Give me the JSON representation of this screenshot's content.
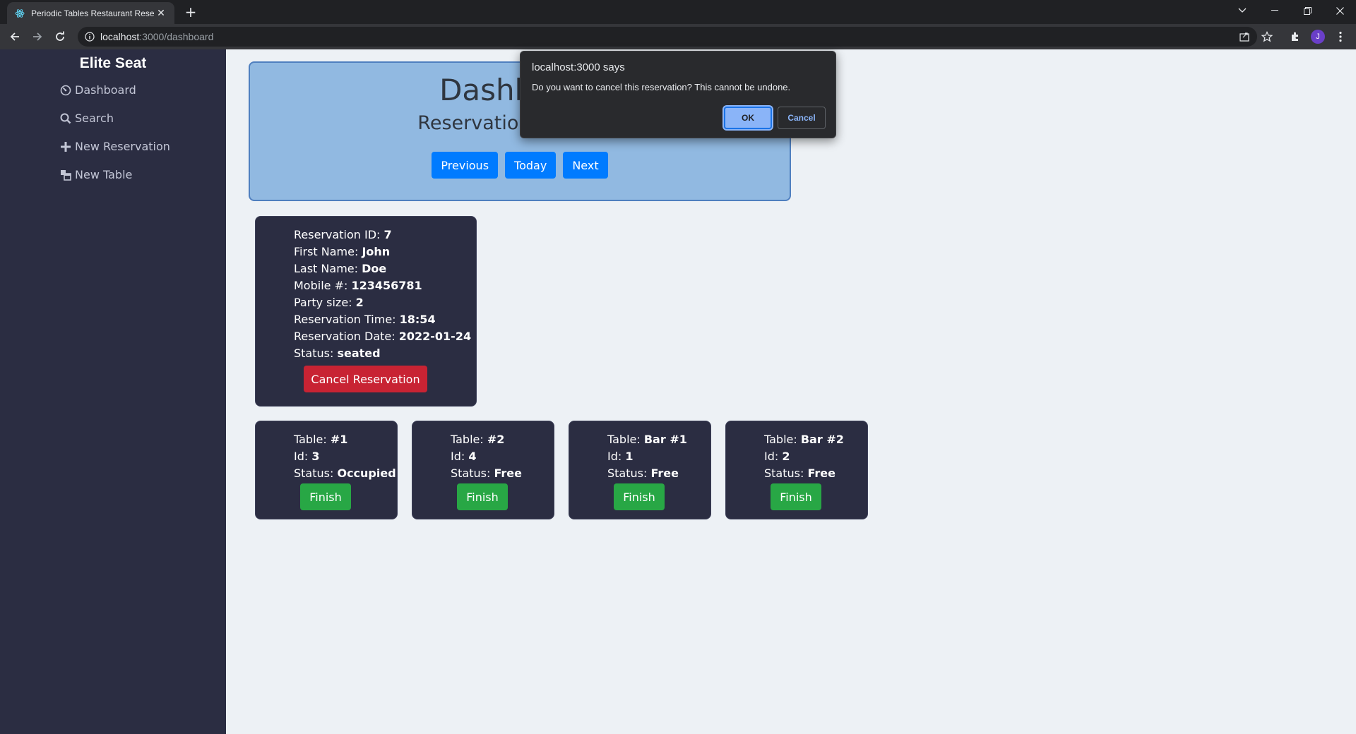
{
  "browser": {
    "tab_title": "Periodic Tables Restaurant Reservation",
    "tab_close": "✕",
    "new_tab": "+",
    "url_host": "localhost",
    "url_path": ":3000/dashboard",
    "profile_initial": "J"
  },
  "sidebar": {
    "brand": "Elite Seat",
    "items": [
      {
        "label": "Dashboard",
        "icon": "dashboard-icon"
      },
      {
        "label": "Search",
        "icon": "search-icon"
      },
      {
        "label": "New Reservation",
        "icon": "plus-icon"
      },
      {
        "label": "New Table",
        "icon": "table-icon"
      }
    ]
  },
  "header": {
    "title": "Dashboard",
    "subtitle": "Reservations for date",
    "buttons": {
      "previous": "Previous",
      "today": "Today",
      "next": "Next"
    }
  },
  "reservation": {
    "fields": [
      {
        "label": "Reservation ID: ",
        "value": "7"
      },
      {
        "label": "First Name: ",
        "value": "John"
      },
      {
        "label": "Last Name: ",
        "value": "Doe"
      },
      {
        "label": "Mobile #: ",
        "value": "123456781"
      },
      {
        "label": "Party size: ",
        "value": "2"
      },
      {
        "label": "Reservation Time: ",
        "value": "18:54"
      },
      {
        "label": "Reservation Date: ",
        "value": "2022-01-24"
      },
      {
        "label": "Status: ",
        "value": "seated"
      }
    ],
    "cancel_label": "Cancel Reservation"
  },
  "tables": [
    {
      "table_label": "Table: ",
      "table": "#1",
      "id_label": "Id: ",
      "id": "3",
      "status_label": "Status: ",
      "status": "Occupied",
      "finish": "Finish"
    },
    {
      "table_label": "Table: ",
      "table": "#2",
      "id_label": "Id: ",
      "id": "4",
      "status_label": "Status: ",
      "status": "Free",
      "finish": "Finish"
    },
    {
      "table_label": "Table: ",
      "table": "Bar #1",
      "id_label": "Id: ",
      "id": "1",
      "status_label": "Status: ",
      "status": "Free",
      "finish": "Finish"
    },
    {
      "table_label": "Table: ",
      "table": "Bar #2",
      "id_label": "Id: ",
      "id": "2",
      "status_label": "Status: ",
      "status": "Free",
      "finish": "Finish"
    }
  ],
  "dialog": {
    "title": "localhost:3000 says",
    "message": "Do you want to cancel this reservation? This cannot be undone.",
    "ok": "OK",
    "cancel": "Cancel"
  },
  "colors": {
    "sidebar_bg": "#2b2d42",
    "header_bg": "#91b9e1",
    "primary": "#007bff",
    "danger": "#c82333",
    "success": "#28a745"
  }
}
